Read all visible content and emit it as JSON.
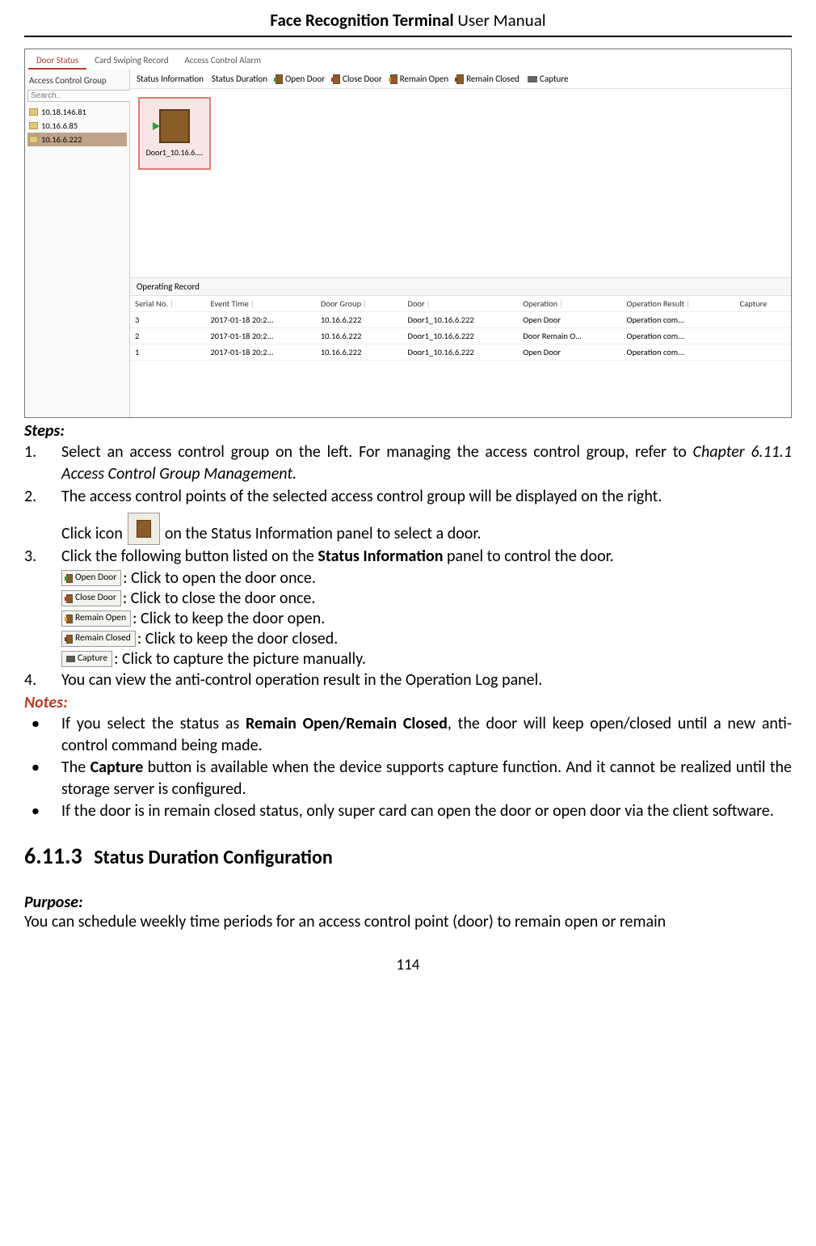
{
  "header": {
    "bold": "Face Recognition Terminal",
    "rest": "  User Manual"
  },
  "page_number": "114",
  "screenshot": {
    "tabs": [
      "Door Status",
      "Card Swiping Record",
      "Access Control Alarm"
    ],
    "sidebar": {
      "title": "Access Control Group",
      "search_placeholder": "Search..",
      "folders": [
        "10.18.146.81",
        "10.16.6.85",
        "10.16.6.222"
      ]
    },
    "toolbar": {
      "status_info": "Status Information",
      "status_dur": "Status Duration",
      "open": "Open Door",
      "close": "Close Door",
      "remain_open": "Remain Open",
      "remain_closed": "Remain Closed",
      "capture": "Capture"
    },
    "door_card_label": "Door1_10.16.6....",
    "op_rec_title": "Operating Record",
    "table": {
      "headers": [
        "Serial No.",
        "Event Time",
        "Door Group",
        "Door",
        "Operation",
        "Operation Result",
        "Capture"
      ],
      "rows": [
        [
          "3",
          "2017-01-18 20:2...",
          "10.16.6.222",
          "Door1_10.16.6.222",
          "Open Door",
          "Operation com...",
          ""
        ],
        [
          "2",
          "2017-01-18 20:2...",
          "10.16.6.222",
          "Door1_10.16.6.222",
          "Door Remain O...",
          "Operation com...",
          ""
        ],
        [
          "1",
          "2017-01-18 20:2...",
          "10.16.6.222",
          "Door1_10.16.6.222",
          "Open Door",
          "Operation com...",
          ""
        ]
      ]
    }
  },
  "doc": {
    "steps_h": "Steps:",
    "step1_a": "Select  an  access  control  group  on  the  left.  For  managing  the  access  control  group,  refer  to ",
    "step1_ref": "Chapter 6.11.1 Access Control Group Management.",
    "step2": "The access control points of the selected access control group will be displayed on the right.",
    "step2_icon_a": "Click icon",
    "step2_icon_b": "on the Status Information panel to select a door.",
    "step3_lead": "Click the following button listed on the ",
    "step3_bold": "Status Information",
    "step3_tail": " panel to control the door.",
    "btns": {
      "open": "Open Door",
      "open_d": ": Click to open the door once.",
      "close": "Close Door",
      "close_d": ": Click to close the door once.",
      "ropen": "Remain Open",
      "ropen_d": ": Click to keep the door open.",
      "rclosed": "Remain Closed",
      "rclosed_d": ": Click to keep the door closed.",
      "cap": "Capture",
      "cap_d": ": Click to capture the picture manually."
    },
    "step4": "You can view the anti-control operation result in the Operation Log panel.",
    "notes_h": "Notes:",
    "note1_a": "If you select the status as ",
    "note1_b": "Remain Open/Remain Closed",
    "note1_c": ", the door will keep open/closed until a new anti-control command being made.",
    "note2_a": "The ",
    "note2_b": "Capture",
    "note2_c": " button is available when the device supports capture function. And it cannot be realized until the storage server is configured.",
    "note3": "If the door is in remain closed status, only super card can open the door or open door via the client software.",
    "sec_num": "6.11.3",
    "sec_title": "Status Duration Configuration",
    "purpose_h": "Purpose:",
    "purpose_body": "You can schedule weekly time periods for an access control point (door) to remain open or remain"
  }
}
